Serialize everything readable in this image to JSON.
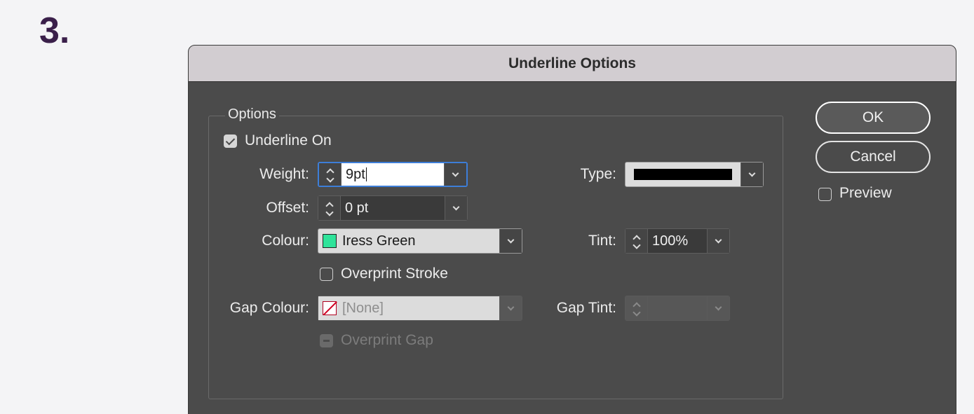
{
  "step_label": "3.",
  "dialog": {
    "title": "Underline Options",
    "group_label": "Options",
    "underline_on": {
      "label": "Underline On",
      "checked": true
    },
    "weight": {
      "label": "Weight:",
      "value": "9pt"
    },
    "offset": {
      "label": "Offset:",
      "value": "0 pt"
    },
    "colour": {
      "label": "Colour:",
      "value": "Iress Green",
      "swatch": "#2fe39a"
    },
    "overprint_stroke": {
      "label": "Overprint Stroke",
      "checked": false
    },
    "gap_colour": {
      "label": "Gap Colour:",
      "value": "[None]"
    },
    "overprint_gap": {
      "label": "Overprint Gap",
      "disabled": true
    },
    "type": {
      "label": "Type:"
    },
    "tint": {
      "label": "Tint:",
      "value": "100%"
    },
    "gap_tint": {
      "label": "Gap Tint:",
      "value": ""
    },
    "buttons": {
      "ok": "OK",
      "cancel": "Cancel"
    },
    "preview": {
      "label": "Preview",
      "checked": false
    }
  }
}
